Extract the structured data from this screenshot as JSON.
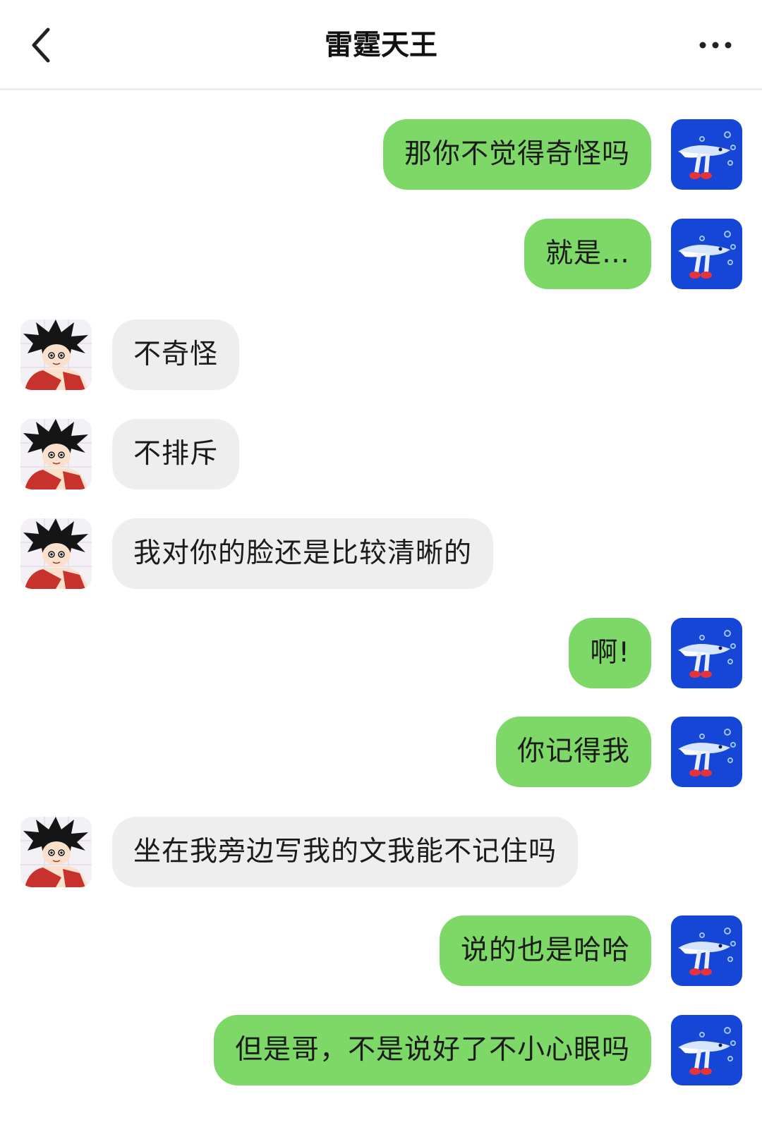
{
  "header": {
    "title": "雷霆天王",
    "back_icon": "chevron-left-icon",
    "more_icon": "more-dots-icon"
  },
  "colors": {
    "outgoing_bubble": "#7dd867",
    "incoming_bubble": "#eeeeee",
    "self_avatar_bg": "#1546d6"
  },
  "messages": [
    {
      "sender": "self",
      "text": "那你不觉得奇怪吗"
    },
    {
      "sender": "self",
      "text": "就是…"
    },
    {
      "sender": "other",
      "text": "不奇怪"
    },
    {
      "sender": "other",
      "text": "不排斥"
    },
    {
      "sender": "other",
      "text": "我对你的脸还是比较清晰的"
    },
    {
      "sender": "self",
      "text": "啊!"
    },
    {
      "sender": "self",
      "text": "你记得我"
    },
    {
      "sender": "other",
      "text": "坐在我旁边写我的文我能不记住吗"
    },
    {
      "sender": "self",
      "text": "说的也是哈哈"
    },
    {
      "sender": "self",
      "text": "但是哥，不是说好了不小心眼吗"
    }
  ]
}
